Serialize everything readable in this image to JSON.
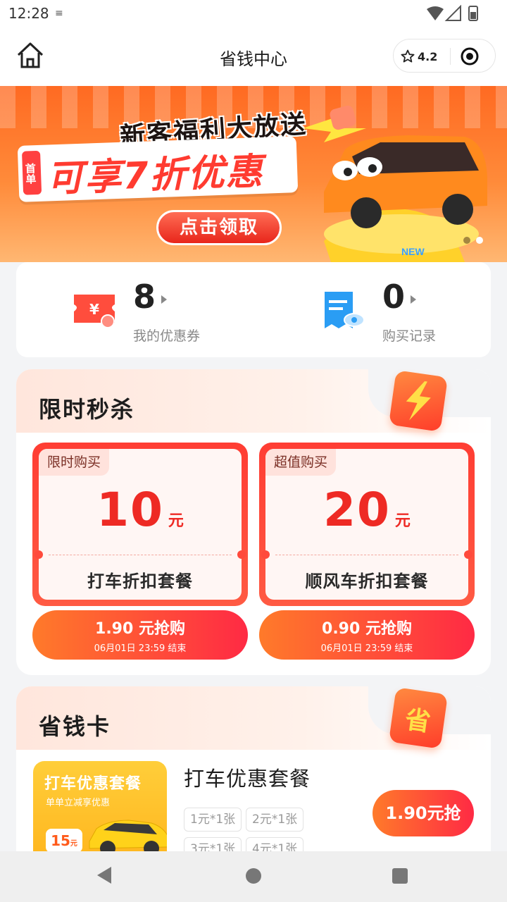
{
  "status_bar": {
    "time": "12:28",
    "notification_icon": "settings-sliders-icon",
    "icons": [
      "wifi-icon",
      "signal-icon",
      "battery-icon"
    ]
  },
  "header": {
    "title": "省钱中心",
    "rating": "4.2",
    "home_icon": "home-icon",
    "capsule_icons": [
      "star-icon",
      "target-icon"
    ]
  },
  "banner": {
    "headline_top": "新客福利大放送",
    "first_order_tag": "首单",
    "headline_main": "可享7折优惠",
    "claim_button": "点击领取",
    "new_badge": "NEW",
    "carousel_total": 2,
    "carousel_active": 2
  },
  "summary": {
    "coupons": {
      "count": "8",
      "label": "我的优惠券",
      "icon": "ticket-yuan-icon"
    },
    "orders": {
      "count": "0",
      "label": "购买记录",
      "icon": "receipt-icon"
    }
  },
  "flash_sale": {
    "title": "限时秒杀",
    "badge_icon": "lightning-icon",
    "deals": [
      {
        "tag": "限时购买",
        "amount": "10",
        "unit": "元",
        "name": "打车折扣套餐",
        "buy_label": "1.90 元抢购",
        "end_time": "06月01日 23:59 结束"
      },
      {
        "tag": "超值购买",
        "amount": "20",
        "unit": "元",
        "name": "顺风车折扣套餐",
        "buy_label": "0.90 元抢购",
        "end_time": "06月01日 23:59 结束"
      }
    ]
  },
  "save_card": {
    "title": "省钱卡",
    "badge_text": "省",
    "package": {
      "image_title": "打车优惠套餐",
      "image_subtitle": "单单立减享优惠",
      "image_price": "15",
      "image_price_unit": "元",
      "name": "打车优惠套餐",
      "chips": [
        "1元*1张",
        "2元*1张",
        "3元*1张",
        "4元*1张"
      ],
      "buy_label": "1.90元抢"
    }
  },
  "colors": {
    "accent_red": "#ee2a24",
    "button_gradient_start": "#ff7a2a",
    "button_gradient_end": "#ff2a44",
    "banner_orange": "#ff6a22"
  }
}
